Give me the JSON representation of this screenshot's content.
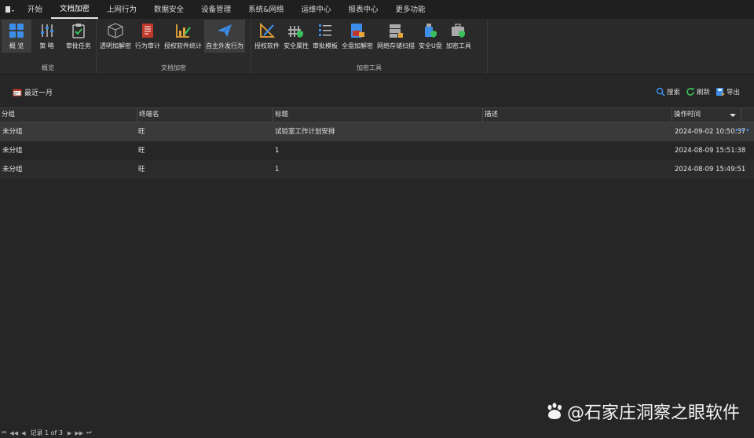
{
  "menu": {
    "tabs": [
      "开始",
      "文档加密",
      "上网行为",
      "数据安全",
      "设备管理",
      "系统&网络",
      "运维中心",
      "报表中心",
      "更多功能"
    ],
    "active_index": 1
  },
  "ribbon": {
    "groups": [
      {
        "label": "概览",
        "items": [
          {
            "label": "概 览",
            "icon": "grid-icon",
            "selected": true
          },
          {
            "label": "策 略",
            "icon": "sliders-icon"
          },
          {
            "label": "审批任务",
            "icon": "clipboard-check-icon"
          }
        ]
      },
      {
        "label": "文档加密",
        "items": [
          {
            "label": "透明加解密",
            "icon": "cube-icon"
          },
          {
            "label": "行为审计",
            "icon": "report-icon"
          },
          {
            "label": "授权软件统计",
            "icon": "chart-pen-icon"
          },
          {
            "label": "自主外发行为",
            "icon": "paper-plane-icon",
            "selected": true
          }
        ]
      },
      {
        "label": "加密工具",
        "items": [
          {
            "label": "授权软件",
            "icon": "ruler-pen-icon"
          },
          {
            "label": "安全属性",
            "icon": "fence-shield-icon"
          },
          {
            "label": "审批模板",
            "icon": "template-list-icon"
          },
          {
            "label": "全盘加解密",
            "icon": "disk-lock-icon"
          },
          {
            "label": "网络存储扫描",
            "icon": "server-scan-icon"
          },
          {
            "label": "安全U盘",
            "icon": "usb-shield-icon"
          },
          {
            "label": "加密工具",
            "icon": "toolbox-shield-icon"
          }
        ]
      }
    ]
  },
  "toolbar": {
    "recent_label": "最近一月",
    "search_label": "搜索",
    "refresh_label": "刷新",
    "export_label": "导出"
  },
  "table": {
    "columns": [
      "分组",
      "终端名",
      "标题",
      "描述",
      "操作时间"
    ],
    "rows": [
      {
        "group": "未分组",
        "terminal": "旺",
        "title": "试验室工作计划安排",
        "desc": "",
        "time": "2024-09-02 10:50:37"
      },
      {
        "group": "未分组",
        "terminal": "旺",
        "title": "1",
        "desc": "",
        "time": "2024-08-09 15:51:38"
      },
      {
        "group": "未分组",
        "terminal": "旺",
        "title": "1",
        "desc": "",
        "time": "2024-08-09 15:49:51"
      }
    ],
    "more_label": "•••"
  },
  "status": {
    "record_text": "记录 1 of 3"
  },
  "watermark": {
    "text": "@石家庄洞察之眼软件"
  },
  "colors": {
    "accent_blue": "#2f8fe8",
    "icon_green": "#3bbf5c",
    "icon_orange": "#e8a53a"
  }
}
